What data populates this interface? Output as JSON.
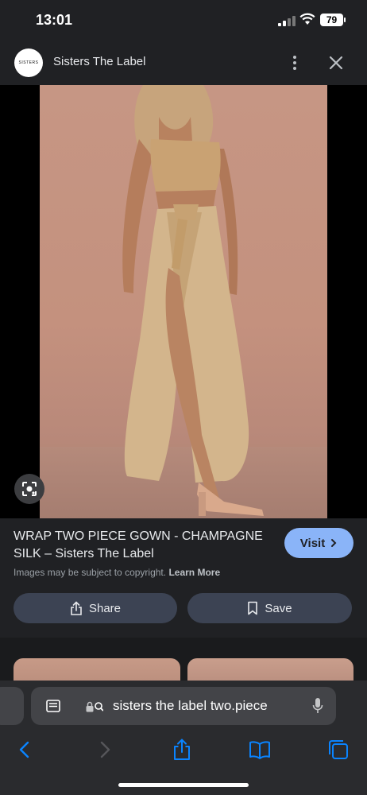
{
  "status_bar": {
    "time": "13:01",
    "battery": "79"
  },
  "header": {
    "logo_text": "SISTERS THE LABEL",
    "site_name": "Sisters The Label"
  },
  "result": {
    "title": "WRAP TWO PIECE GOWN - CHAMPAGNE SILK – Sisters The Label",
    "visit_label": "Visit",
    "copyright_text": "Images may be subject to copyright.",
    "learn_more_label": "Learn More",
    "share_label": "Share",
    "save_label": "Save"
  },
  "url_bar": {
    "url": "sisters the label two.piece"
  },
  "colors": {
    "accent": "#8ab4f8",
    "ios_blue": "#0a84ff",
    "background": "#202124"
  },
  "icons": [
    "signal-icon",
    "wifi-icon",
    "battery-icon",
    "more-icon",
    "close-icon",
    "lens-icon",
    "chevron-right-icon",
    "share-icon",
    "bookmark-icon",
    "reader-icon",
    "lock-icon",
    "search-icon",
    "mic-icon",
    "back-icon",
    "forward-icon",
    "safari-share-icon",
    "bookmarks-icon",
    "tabs-icon"
  ]
}
